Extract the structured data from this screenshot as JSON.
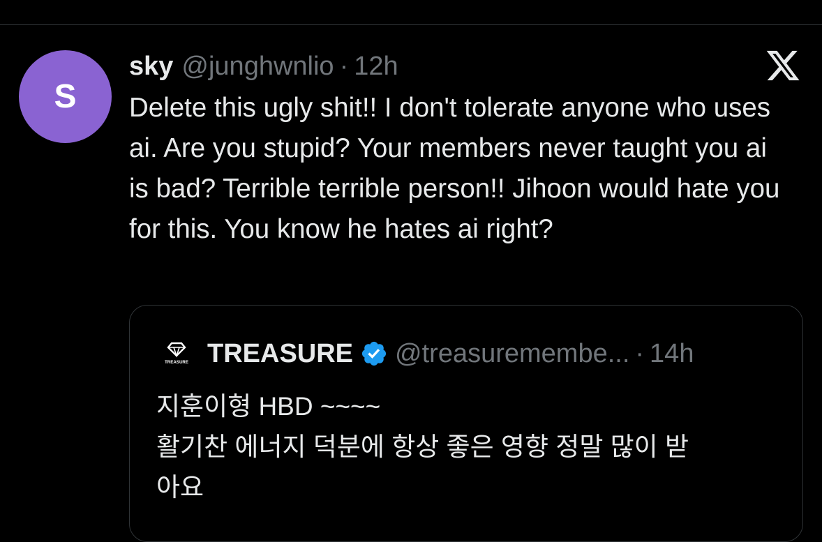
{
  "tweet": {
    "avatar_letter": "S",
    "avatar_color": "#8a63d2",
    "display_name": "sky",
    "handle": "@junghwnlio",
    "separator": "·",
    "time": "12h",
    "text": "Delete this ugly shit!! I don't tolerate anyone who uses ai. Are you stupid? Your members never taught you ai is bad? Terrible terrible person!! Jihoon would hate you for this. You know he hates ai right?",
    "platform_icon": "x-logo-icon"
  },
  "quoted_tweet": {
    "logo_text": "TREASURE",
    "display_name": "TREASURE",
    "verified_icon": "verified-badge-icon",
    "verified_color": "#1d9bf0",
    "handle": "@treasuremembe...",
    "separator": "·",
    "time": "14h",
    "lines": [
      "지훈이형 HBD ~~~~",
      "활기찬 에너지 덕분에 항상 좋은 영향 정말 많이 받",
      "아요"
    ]
  }
}
